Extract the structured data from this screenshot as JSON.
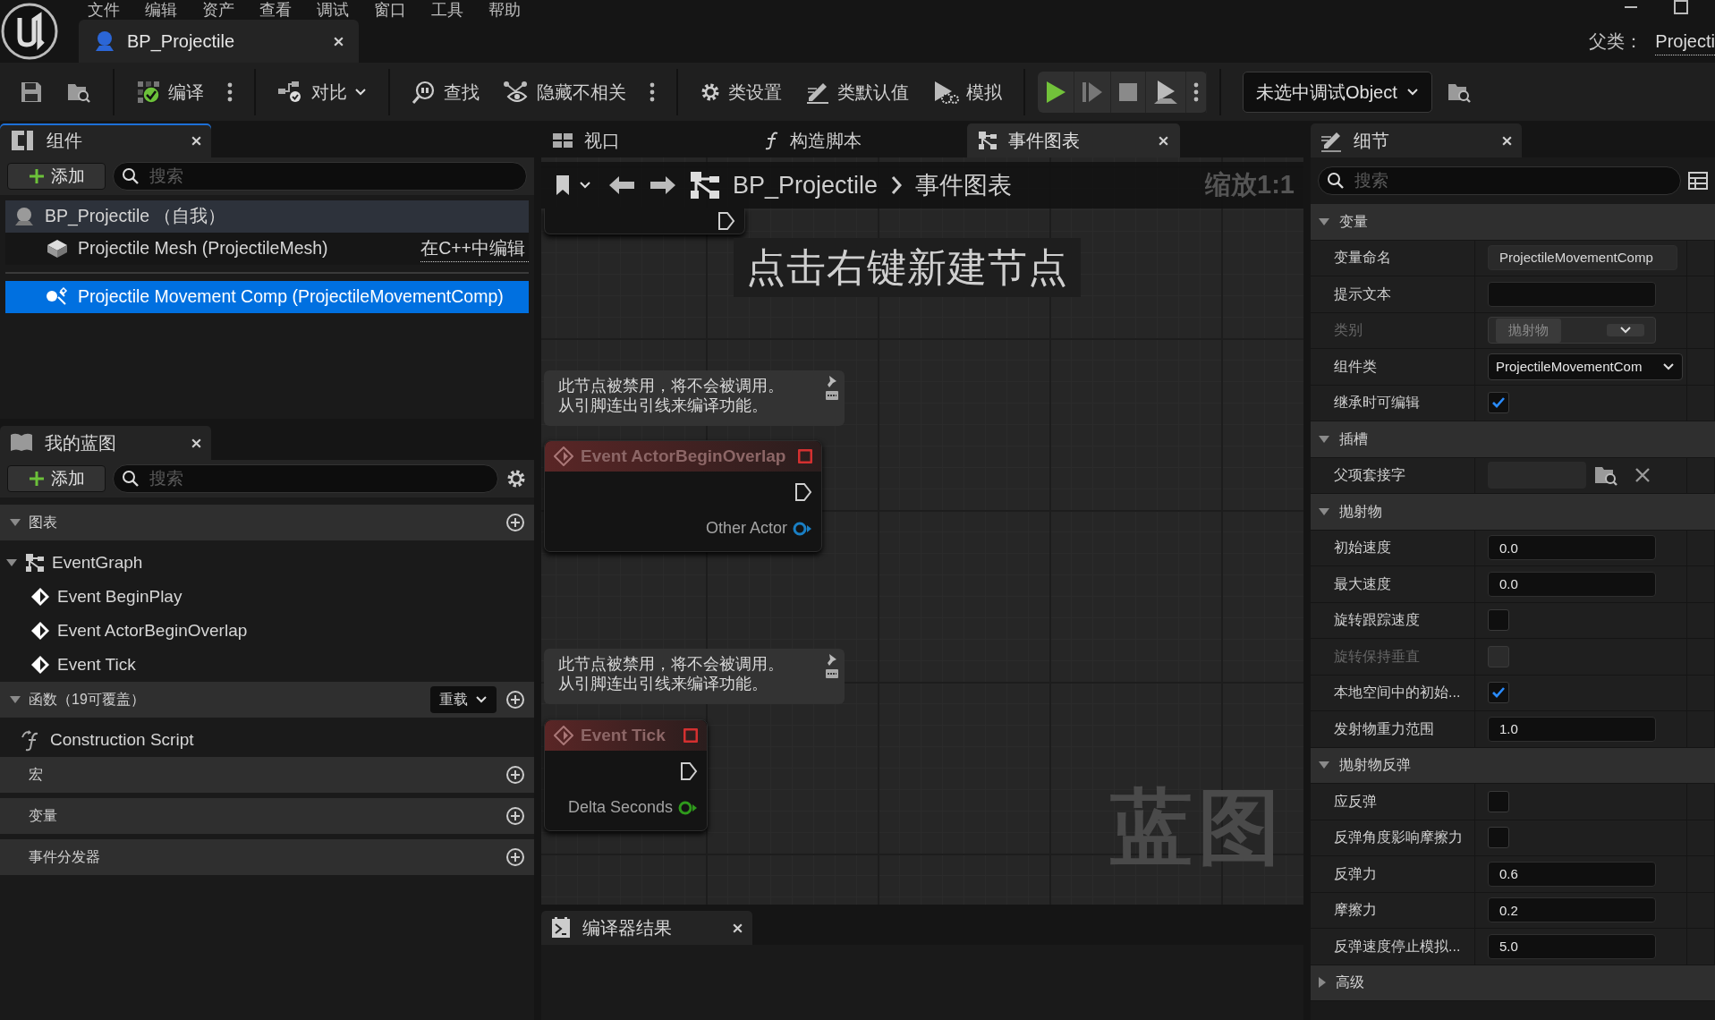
{
  "menu": [
    "文件",
    "编辑",
    "资产",
    "查看",
    "调试",
    "窗口",
    "工具",
    "帮助"
  ],
  "document_tab": {
    "title": "BP_Projectile"
  },
  "parent_class": {
    "label": "父类：",
    "value": "Projecti"
  },
  "toolbar": {
    "compile": "编译",
    "diff": "对比",
    "find": "查找",
    "hide_unrelated": "隐藏不相关",
    "class_settings": "类设置",
    "class_defaults": "类默认值",
    "simulate": "模拟",
    "debug_object": "未选中调试Object"
  },
  "components": {
    "tab": "组件",
    "add": "添加",
    "search": {
      "placeholder": "搜索"
    },
    "tree": [
      {
        "label": "BP_Projectile （自我）",
        "selected": false,
        "children": [
          {
            "label": "Projectile Mesh (ProjectileMesh)",
            "action": "在C++中编辑",
            "selected": false
          },
          {
            "label": "Projectile Movement Comp (ProjectileMovementComp)",
            "selected": true
          }
        ]
      }
    ]
  },
  "my_blueprint": {
    "tab": "我的蓝图",
    "add": "添加",
    "search": {
      "placeholder": "搜索"
    },
    "sections": [
      {
        "label": "图表",
        "expanded": true,
        "items": [
          {
            "kind": "graph",
            "label": "EventGraph",
            "expanded": true,
            "children": [
              {
                "kind": "event",
                "label": "Event BeginPlay"
              },
              {
                "kind": "event",
                "label": "Event ActorBeginOverlap"
              },
              {
                "kind": "event",
                "label": "Event Tick"
              }
            ]
          }
        ]
      },
      {
        "label": "函数（19可覆盖）",
        "expanded": true,
        "override": "重载",
        "items": [
          {
            "kind": "function",
            "label": "Construction Script"
          }
        ]
      },
      {
        "label": "宏",
        "expanded": false
      },
      {
        "label": "变量",
        "expanded": false
      },
      {
        "label": "事件分发器",
        "expanded": false
      }
    ]
  },
  "editor_tabs": [
    {
      "label": "视口",
      "selected": false
    },
    {
      "label": "构造脚本",
      "selected": false
    },
    {
      "label": "事件图表",
      "selected": true
    }
  ],
  "graph": {
    "breadcrumb": [
      "BP_Projectile",
      "事件图表"
    ],
    "zoom": "缩放1:1",
    "hint": "点击右键新建节点",
    "corner_text": "蓝图",
    "nodes": [
      {
        "comment": [
          "此节点被禁用，将不会被调用。",
          "从引脚连出引线来编译功能。"
        ],
        "title": "Event ActorBeginOverlap",
        "disabled": true,
        "pin": {
          "label": "Other Actor",
          "color": "#1a7fc4"
        }
      },
      {
        "comment": [
          "此节点被禁用，将不会被调用。",
          "从引脚连出引线来编译功能。"
        ],
        "title": "Event Tick",
        "disabled": true,
        "pin": {
          "label": "Delta Seconds",
          "color": "#2f9a1c"
        }
      }
    ]
  },
  "compiler_results": {
    "tab": "编译器结果"
  },
  "details": {
    "tab": "细节",
    "search": {
      "placeholder": "搜索"
    },
    "sections": [
      {
        "label": "变量",
        "expanded": true,
        "properties": [
          {
            "label": "变量命名",
            "kind": "name",
            "value": "ProjectileMovementComp"
          },
          {
            "label": "提示文本",
            "kind": "input"
          },
          {
            "label": "类别",
            "kind": "combo",
            "value": "抛射物",
            "disabled": true
          },
          {
            "label": "组件类",
            "kind": "dropdown",
            "value": "ProjectileMovementCom"
          },
          {
            "label": "继承时可编辑",
            "kind": "checkbox",
            "checked": true,
            "disabled": false
          }
        ]
      },
      {
        "label": "插槽",
        "expanded": true,
        "properties": [
          {
            "label": "父项套接字",
            "kind": "socket"
          }
        ]
      },
      {
        "label": "抛射物",
        "expanded": true,
        "properties": [
          {
            "label": "初始速度",
            "kind": "input",
            "value": "0.0"
          },
          {
            "label": "最大速度",
            "kind": "input",
            "value": "0.0"
          },
          {
            "label": "旋转跟踪速度",
            "kind": "checkbox",
            "checked": false,
            "disabled": false
          },
          {
            "label": "旋转保持垂直",
            "kind": "checkbox",
            "checked": false,
            "disabled": true
          },
          {
            "label": "本地空间中的初始...",
            "kind": "checkbox",
            "checked": true,
            "disabled": false
          },
          {
            "label": "发射物重力范围",
            "kind": "input",
            "value": "1.0"
          }
        ]
      },
      {
        "label": "抛射物反弹",
        "expanded": true,
        "properties": [
          {
            "label": "应反弹",
            "kind": "checkbox",
            "checked": false,
            "disabled": false
          },
          {
            "label": "反弹角度影响摩擦力",
            "kind": "checkbox",
            "checked": false,
            "disabled": false
          },
          {
            "label": "反弹力",
            "kind": "input",
            "value": "0.6"
          },
          {
            "label": "摩擦力",
            "kind": "input",
            "value": "0.2"
          },
          {
            "label": "反弹速度停止模拟...",
            "kind": "input",
            "value": "5.0"
          }
        ]
      },
      {
        "label": "高级",
        "expanded": false
      }
    ]
  }
}
